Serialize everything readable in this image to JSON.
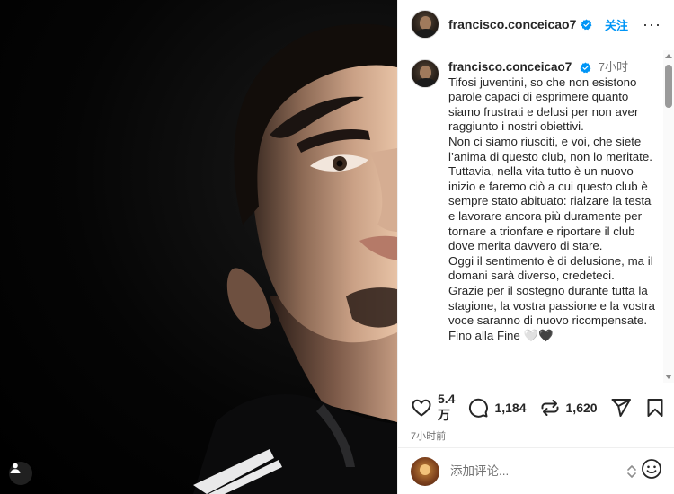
{
  "post": {
    "username": "francisco.conceicao7",
    "follow_label": "关注",
    "more_label": "···",
    "time_ago": "7小时",
    "caption_paragraphs": [
      "Tifosi juventini, so che non esistono parole capaci di esprimere quanto siamo frustrati e delusi per non aver raggiunto i nostri obiettivi.",
      "Non ci siamo riusciti, e voi, che siete l’anima di questo club, non lo meritate.",
      "Tuttavia, nella vita tutto è un nuovo inizio e faremo ciò a cui questo club è sempre stato abituato: rialzare la testa e lavorare ancora più duramente per tornare a trionfare e riportare il club dove merita davvero di stare.",
      "Oggi il sentimento è di delusione, ma il domani sarà diverso, credeteci.",
      "Grazie per il sostegno durante tutta la stagione, la vostra passione e la vostra voce saranno di nuovo ricompensate.",
      "Fino alla Fine 🤍🖤"
    ],
    "likes": "5.4 万",
    "comments": "1,184",
    "reposts": "1,620",
    "posted_ago": "7小时前"
  },
  "comment_box": {
    "placeholder": "添加评论..."
  },
  "icons": {
    "verified": "verified-badge-icon",
    "like": "heart-icon",
    "comment": "comment-bubble-icon",
    "repost": "repost-icon",
    "share": "send-icon",
    "save": "bookmark-icon",
    "emoji": "emoji-icon",
    "user_tag": "user-tag-icon"
  },
  "colors": {
    "accent": "#0095f6",
    "text": "#262626",
    "muted": "#737373",
    "divider": "#efefef"
  }
}
